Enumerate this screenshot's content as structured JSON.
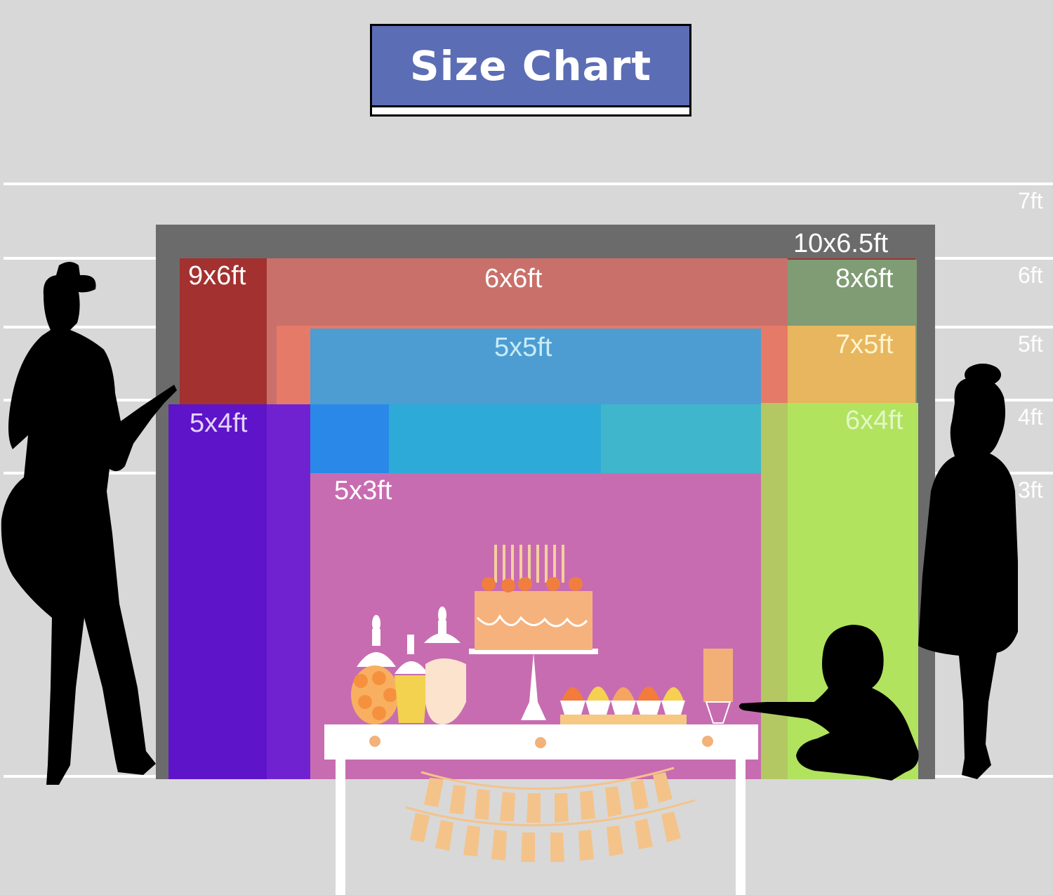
{
  "title": "Size Chart",
  "height_marks": [
    "7ft",
    "6ft",
    "5ft",
    "4ft",
    "3ft"
  ],
  "sizes": {
    "s10x6_5": "10x6.5ft",
    "s9x6": "9x6ft",
    "s6x6": "6x6ft",
    "s8x6": "8x6ft",
    "s5x5": "5x5ft",
    "s7x5": "7x5ft",
    "s5x4": "5x4ft",
    "s6x4": "6x4ft",
    "s5x3": "5x3ft"
  },
  "colors": {
    "background": "#d8d8d8",
    "title_band": "#5b6db4",
    "s10x6_5": "#6b6b6b",
    "s9x6": "#a3312f",
    "s6x6": "#c9706a",
    "s8x6": "#7f9c74",
    "s5x5": "#4d9dd2",
    "s7x5": "#e7b65e",
    "s5x4": "#5e14c8",
    "s6x4": "#b1e35f",
    "s5x3": "#c86cb1",
    "silhouette": "#000000"
  }
}
